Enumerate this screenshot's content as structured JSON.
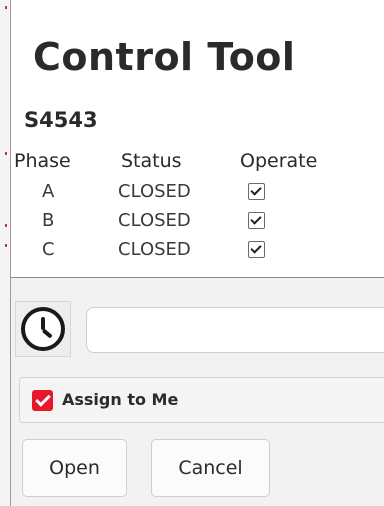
{
  "title": "Control Tool",
  "device_id": "S4543",
  "table": {
    "headers": {
      "phase": "Phase",
      "status": "Status",
      "operate": "Operate"
    },
    "rows": [
      {
        "phase": "A",
        "status": "CLOSED",
        "operate": true
      },
      {
        "phase": "B",
        "status": "CLOSED",
        "operate": true
      },
      {
        "phase": "C",
        "status": "CLOSED",
        "operate": true
      }
    ]
  },
  "schedule": {
    "icon": "clock-icon",
    "time_value": "",
    "time_placeholder": ""
  },
  "assign": {
    "label": "Assign to Me",
    "checked": true,
    "accent": "#e8182b"
  },
  "buttons": {
    "open_label": "Open",
    "cancel_label": "Cancel"
  }
}
